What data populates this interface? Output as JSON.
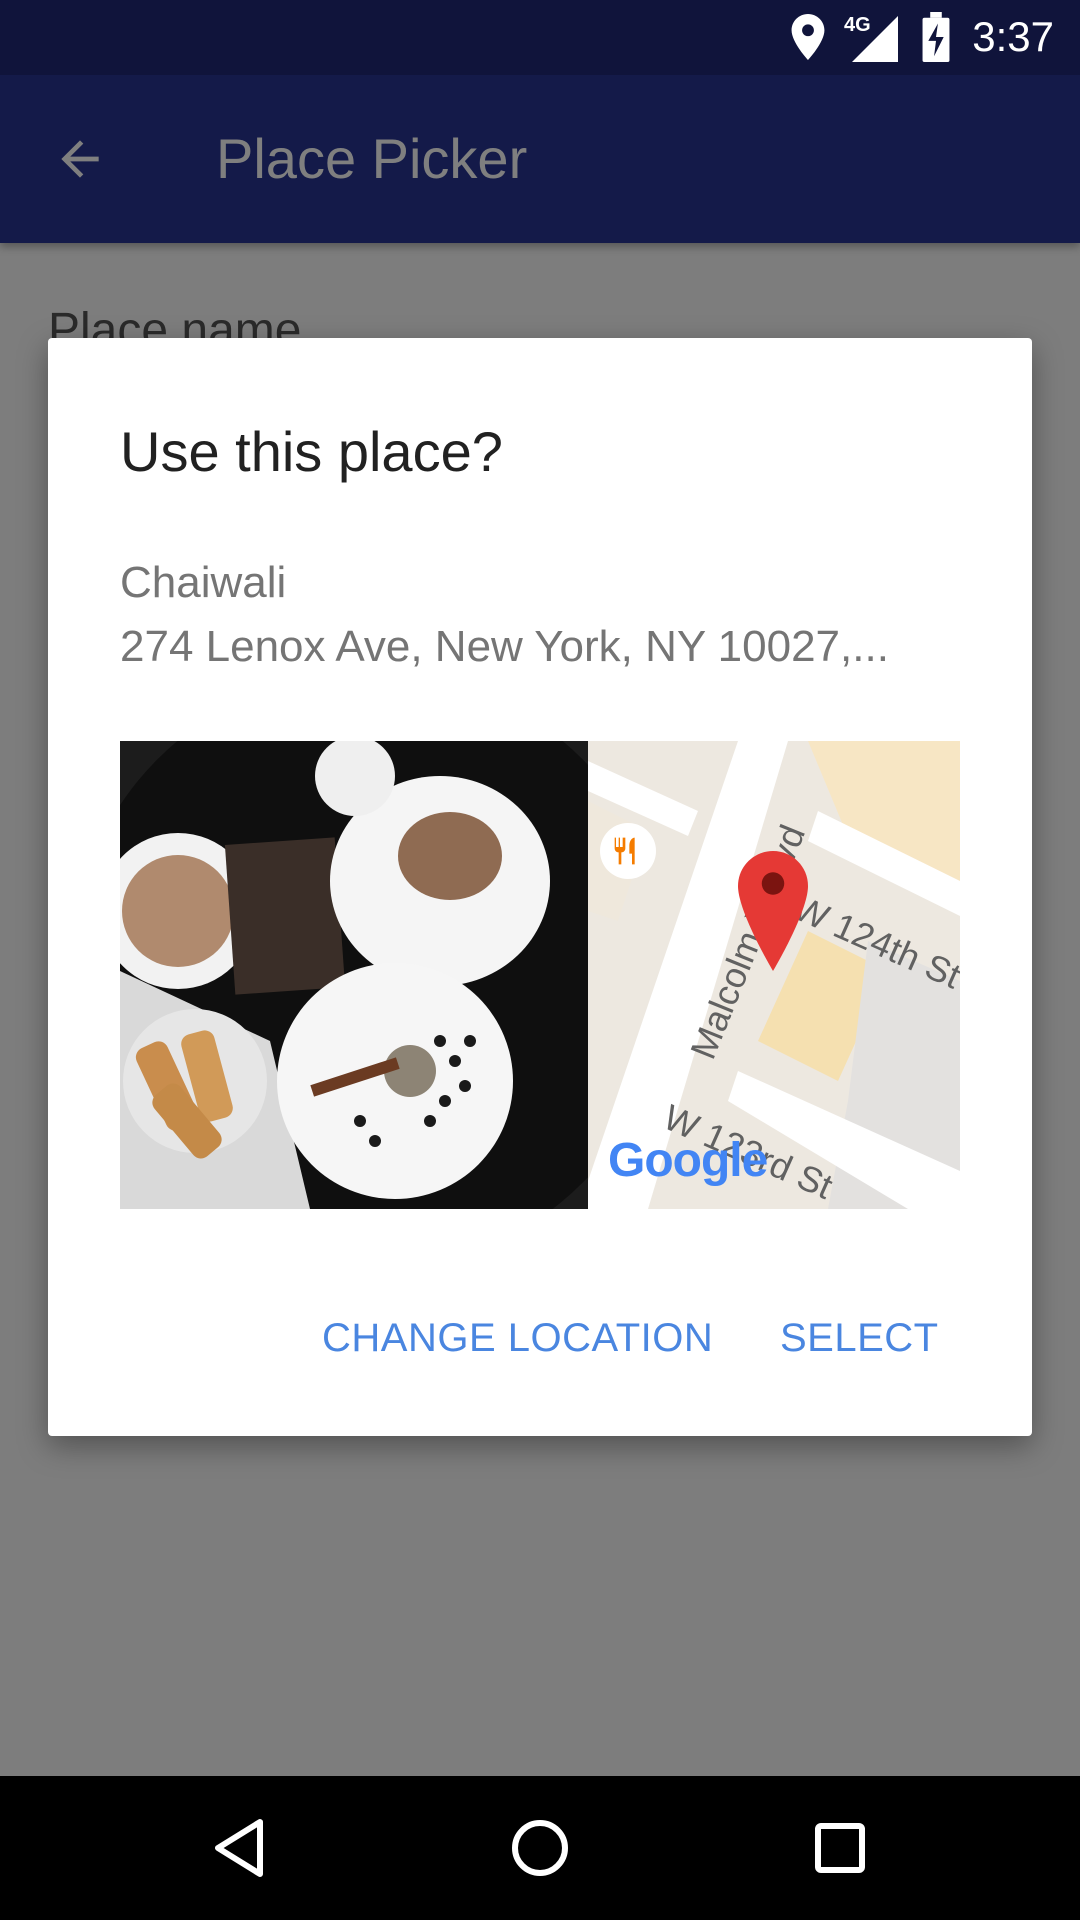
{
  "status_bar": {
    "time": "3:37",
    "network_label": "4G",
    "icons": [
      "location-icon",
      "signal-icon",
      "battery-charging-icon"
    ]
  },
  "app_bar": {
    "title": "Place Picker",
    "back_icon": "arrow-back-icon",
    "color": "#283593"
  },
  "content": {
    "field_label": "Place name"
  },
  "dialog": {
    "title": "Use this place?",
    "place_name": "Chaiwali",
    "place_address": "274 Lenox Ave, New York, NY 10027,...",
    "photo_description_icon": "place-photo",
    "map": {
      "streets": [
        "Malcolm X Blvd",
        "W 124th St",
        "W 123rd St"
      ],
      "attribution": "Google",
      "marker_icon": "map-pin-icon",
      "poi_icon": "restaurant-icon"
    },
    "actions": {
      "change_location": "CHANGE LOCATION",
      "select": "SELECT"
    },
    "accent_color": "#4a86e0"
  },
  "nav_bar": {
    "icons": [
      "back-triangle-icon",
      "home-circle-icon",
      "recents-square-icon"
    ]
  }
}
